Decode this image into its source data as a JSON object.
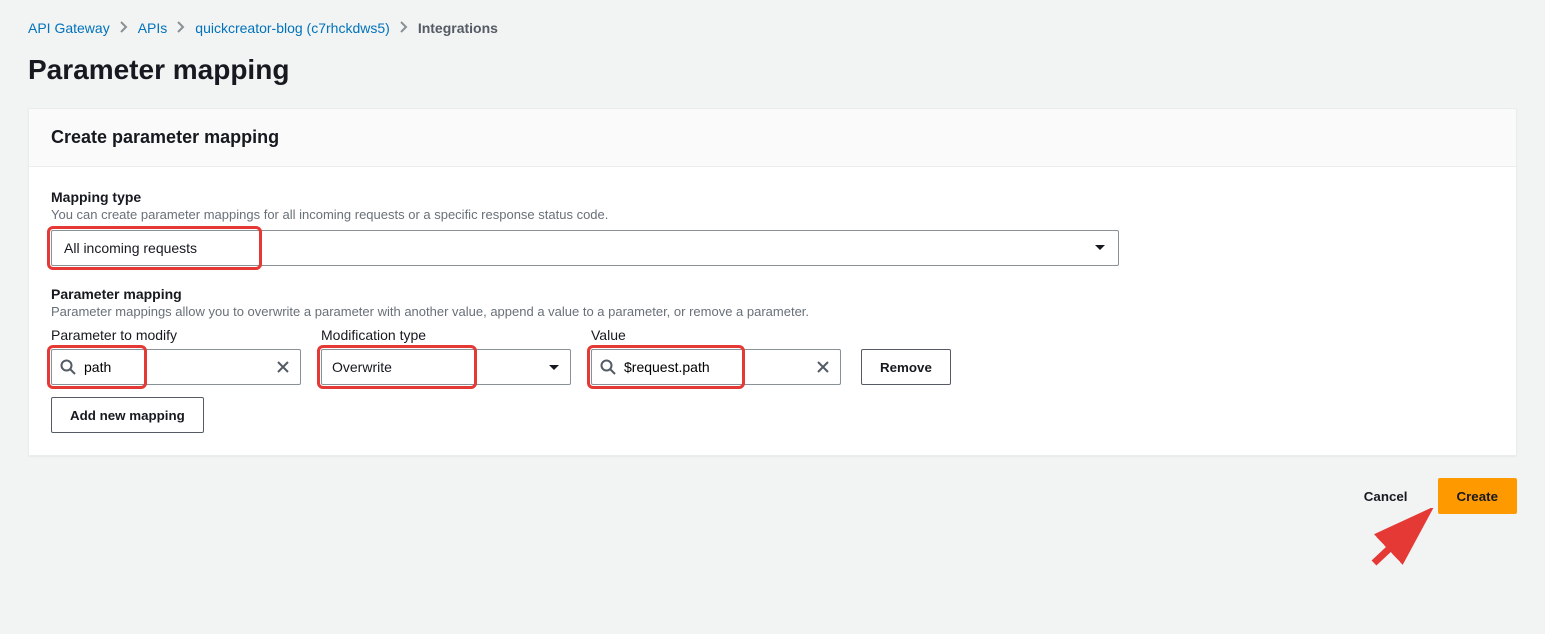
{
  "breadcrumb": {
    "items": [
      {
        "label": "API Gateway",
        "link": true
      },
      {
        "label": "APIs",
        "link": true
      },
      {
        "label": "quickcreator-blog (c7rhckdws5)",
        "link": true
      },
      {
        "label": "Integrations",
        "link": false
      }
    ]
  },
  "page": {
    "title": "Parameter mapping"
  },
  "panel": {
    "title": "Create parameter mapping"
  },
  "mapping_type": {
    "label": "Mapping type",
    "description": "You can create parameter mappings for all incoming requests or a specific response status code.",
    "value": "All incoming requests"
  },
  "parameter_mapping": {
    "label": "Parameter mapping",
    "description": "Parameter mappings allow you to overwrite a parameter with another value, append a value to a parameter, or remove a parameter.",
    "columns": {
      "parameter_to_modify": "Parameter to modify",
      "modification_type": "Modification type",
      "value": "Value"
    },
    "row": {
      "parameter": "path",
      "modification": "Overwrite",
      "value": "$request.path"
    },
    "remove_label": "Remove",
    "add_label": "Add new mapping"
  },
  "actions": {
    "cancel": "Cancel",
    "create": "Create"
  }
}
